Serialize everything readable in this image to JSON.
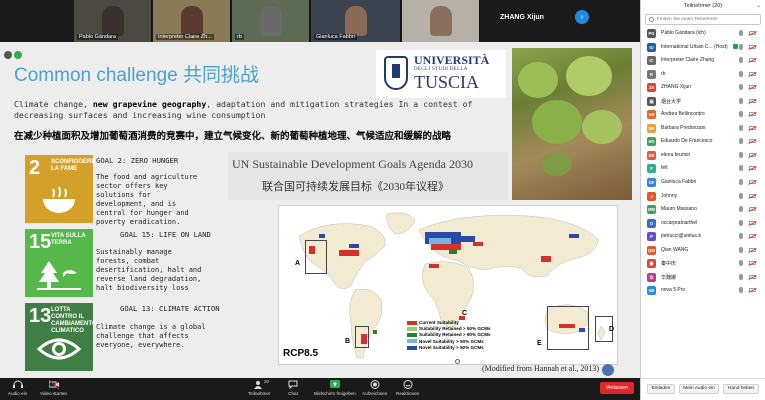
{
  "videos": [
    {
      "name": "Pablo Gándara",
      "face": "#3a3030",
      "bg": "#4a4a42"
    },
    {
      "name": "Interpreter Claire Zh...",
      "face": "#5a3a2e",
      "bg": "#8a7a55"
    },
    {
      "name": "rb",
      "face": "#6a6a6a",
      "bg": "#5d6b54"
    },
    {
      "name": "Gianluca Fabbri",
      "face": "#8a6a56",
      "bg": "#3c4450"
    },
    {
      "name": "",
      "face": "#8a6d5c",
      "bg": "#b5b0a8"
    }
  ],
  "speaker_name": "ZHANG Xijun",
  "slide": {
    "title": "Common challenge 共同挑战",
    "logo": {
      "line1": "UNIVERSITÀ",
      "line2": "DEGLI STUDI DELLA",
      "line3": "TUSCIA"
    },
    "intro_prefix": "Climate change, ",
    "intro_bold": "new grapevine geography",
    "intro_suffix": ", adaptation and mitigation strategies In a contest of decreasing  surfaces  and increasing wine consumption",
    "intro_cn": "在减少种植面积及增加葡萄酒消费的竞赛中，建立气候变化、新的葡萄种植地理、气候适应和缓解的战略",
    "sdgs": [
      {
        "num": "2",
        "label": "SCONFIGGERE LA FAME",
        "color": "#d3a029",
        "goal_title": "GOAL 2: ZERO HUNGER",
        "goal_text": "The food and agriculture\nsector offers key\nsolutions for\ndevelopment, and is\ncentral for hunger and\npoverty eradication."
      },
      {
        "num": "15",
        "label": "VITA SULLA TERRA",
        "color": "#56b84b",
        "goal_title": "GOAL 15: LIFE ON LAND",
        "goal_text": "Sustainably manage\nforests, combat\ndesertification, halt and\nreverse land degradation,\nhalt biodiversity loss"
      },
      {
        "num": "13",
        "label": "LOTTA CONTRO IL CAMBIAMENTO CLIMATICO",
        "color": "#3f7e44",
        "goal_title": "GOAL 13: CLIMATE ACTION",
        "goal_text": "Climate change is a global\nchallenge that affects\neveryone, everywhere."
      }
    ],
    "un_title": "UN Sustainable Development Goals  Agenda 2030",
    "un_title_cn": "联合国可持续发展目标《2030年议程》",
    "map": {
      "labels": [
        "A",
        "B",
        "C",
        "D",
        "E"
      ],
      "legend": [
        {
          "label": "Current Suitability",
          "color": "#d6302a"
        },
        {
          "label": "Suitability Retained > 50% GCMs",
          "color": "#8fd168"
        },
        {
          "label": "Suitability Retained > 90% GCMs",
          "color": "#2f7a2a"
        },
        {
          "label": "Novel Suitability > 50% GCMs",
          "color": "#6fb3e8"
        },
        {
          "label": "Novel Suitability > 90% GCMs",
          "color": "#2a4aa8"
        }
      ],
      "scenario": "RCP8.5",
      "caption": "(Modified from Hannah  et al., 2013)"
    }
  },
  "toolbar": {
    "audio": "Audio ein",
    "video": "Video starten",
    "participants_count": "20",
    "participants": "Teilnehmer",
    "chat": "Chat",
    "share": "Bildschirm freigeben",
    "record": "Aufzeichnen",
    "reactions": "Reaktionen",
    "leave": "Verlassen"
  },
  "panel": {
    "title": "Teilnehmer (20)",
    "search_placeholder": "Finden Sie einen Teilnehmer",
    "participants": [
      {
        "initials": "PG",
        "name": "Pablo Gándara (ich)",
        "color": "#555555"
      },
      {
        "initials": "IU",
        "name": "International Urban C... (Host)",
        "color": "#1f5fa8"
      },
      {
        "initials": "IC",
        "name": "Interpreter Claire Zhang",
        "color": "#666666"
      },
      {
        "initials": "R",
        "name": "rb",
        "color": "#777777"
      },
      {
        "initials": "ZX",
        "name": "ZHANG Xijun",
        "color": "#e0442e"
      },
      {
        "initials": "烟",
        "name": "烟台大学",
        "color": "#555555"
      },
      {
        "initials": "AB",
        "name": "Andrea Bellincontro",
        "color": "#e06a2c"
      },
      {
        "initials": "BP",
        "name": "Barbara Predonzani",
        "color": "#e8a23a"
      },
      {
        "initials": "ED",
        "name": "Eduardo De Francesco",
        "color": "#3aa35a"
      },
      {
        "initials": "EB",
        "name": "elena brunori",
        "color": "#e05a3a"
      },
      {
        "initials": "F",
        "name": "felt",
        "color": "#2fae8e"
      },
      {
        "initials": "GF",
        "name": "Gianluca Fabbri",
        "color": "#3b82d0"
      },
      {
        "initials": "J",
        "name": "Johnny",
        "color": "#e0572e"
      },
      {
        "initials": "MM",
        "name": "Mauro Massano",
        "color": "#3aa35a"
      },
      {
        "initials": "O",
        "name": "occarpratnarthel",
        "color": "#2f6fd0"
      },
      {
        "initials": "P",
        "name": "petrucci@unitus.it",
        "color": "#6a4ed0"
      },
      {
        "initials": "QW",
        "name": "Qian WANG",
        "color": "#e0572e"
      },
      {
        "initials": "秦",
        "name": "秦中庆",
        "color": "#e0442e"
      },
      {
        "initials": "华",
        "name": "华魏娜",
        "color": "#c03a8a"
      },
      {
        "initials": "N5",
        "name": "nova 5 Pro",
        "color": "#2f8fd0"
      }
    ],
    "btn_invite": "Einladen",
    "btn_mute": "Mein Audio ein",
    "btn_raise": "Hand heben"
  },
  "colors": {
    "accent": "#4aa3c8",
    "leave": "#e02828"
  }
}
